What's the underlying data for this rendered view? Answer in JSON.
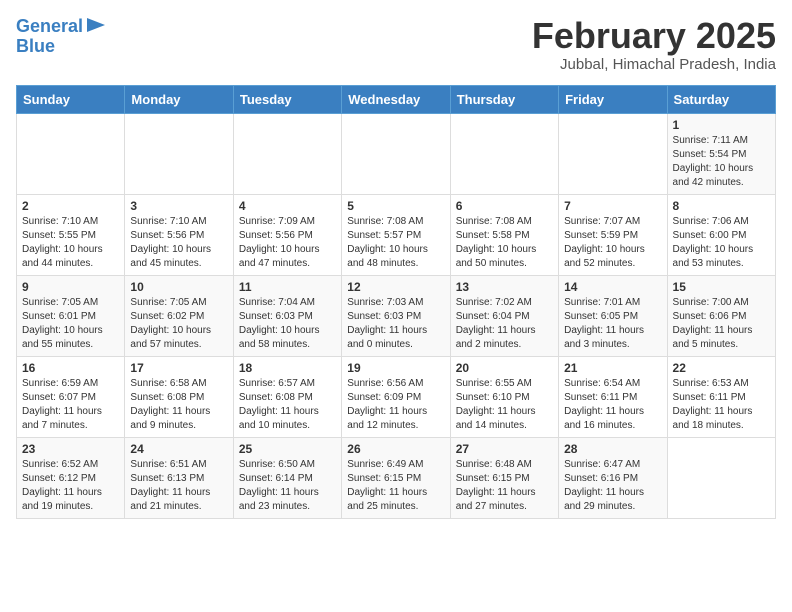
{
  "header": {
    "logo_line1": "General",
    "logo_line2": "Blue",
    "month_title": "February 2025",
    "location": "Jubbal, Himachal Pradesh, India"
  },
  "calendar": {
    "days_of_week": [
      "Sunday",
      "Monday",
      "Tuesday",
      "Wednesday",
      "Thursday",
      "Friday",
      "Saturday"
    ],
    "weeks": [
      [
        {
          "day": "",
          "info": ""
        },
        {
          "day": "",
          "info": ""
        },
        {
          "day": "",
          "info": ""
        },
        {
          "day": "",
          "info": ""
        },
        {
          "day": "",
          "info": ""
        },
        {
          "day": "",
          "info": ""
        },
        {
          "day": "1",
          "info": "Sunrise: 7:11 AM\nSunset: 5:54 PM\nDaylight: 10 hours\nand 42 minutes."
        }
      ],
      [
        {
          "day": "2",
          "info": "Sunrise: 7:10 AM\nSunset: 5:55 PM\nDaylight: 10 hours\nand 44 minutes."
        },
        {
          "day": "3",
          "info": "Sunrise: 7:10 AM\nSunset: 5:56 PM\nDaylight: 10 hours\nand 45 minutes."
        },
        {
          "day": "4",
          "info": "Sunrise: 7:09 AM\nSunset: 5:56 PM\nDaylight: 10 hours\nand 47 minutes."
        },
        {
          "day": "5",
          "info": "Sunrise: 7:08 AM\nSunset: 5:57 PM\nDaylight: 10 hours\nand 48 minutes."
        },
        {
          "day": "6",
          "info": "Sunrise: 7:08 AM\nSunset: 5:58 PM\nDaylight: 10 hours\nand 50 minutes."
        },
        {
          "day": "7",
          "info": "Sunrise: 7:07 AM\nSunset: 5:59 PM\nDaylight: 10 hours\nand 52 minutes."
        },
        {
          "day": "8",
          "info": "Sunrise: 7:06 AM\nSunset: 6:00 PM\nDaylight: 10 hours\nand 53 minutes."
        }
      ],
      [
        {
          "day": "9",
          "info": "Sunrise: 7:05 AM\nSunset: 6:01 PM\nDaylight: 10 hours\nand 55 minutes."
        },
        {
          "day": "10",
          "info": "Sunrise: 7:05 AM\nSunset: 6:02 PM\nDaylight: 10 hours\nand 57 minutes."
        },
        {
          "day": "11",
          "info": "Sunrise: 7:04 AM\nSunset: 6:03 PM\nDaylight: 10 hours\nand 58 minutes."
        },
        {
          "day": "12",
          "info": "Sunrise: 7:03 AM\nSunset: 6:03 PM\nDaylight: 11 hours\nand 0 minutes."
        },
        {
          "day": "13",
          "info": "Sunrise: 7:02 AM\nSunset: 6:04 PM\nDaylight: 11 hours\nand 2 minutes."
        },
        {
          "day": "14",
          "info": "Sunrise: 7:01 AM\nSunset: 6:05 PM\nDaylight: 11 hours\nand 3 minutes."
        },
        {
          "day": "15",
          "info": "Sunrise: 7:00 AM\nSunset: 6:06 PM\nDaylight: 11 hours\nand 5 minutes."
        }
      ],
      [
        {
          "day": "16",
          "info": "Sunrise: 6:59 AM\nSunset: 6:07 PM\nDaylight: 11 hours\nand 7 minutes."
        },
        {
          "day": "17",
          "info": "Sunrise: 6:58 AM\nSunset: 6:08 PM\nDaylight: 11 hours\nand 9 minutes."
        },
        {
          "day": "18",
          "info": "Sunrise: 6:57 AM\nSunset: 6:08 PM\nDaylight: 11 hours\nand 10 minutes."
        },
        {
          "day": "19",
          "info": "Sunrise: 6:56 AM\nSunset: 6:09 PM\nDaylight: 11 hours\nand 12 minutes."
        },
        {
          "day": "20",
          "info": "Sunrise: 6:55 AM\nSunset: 6:10 PM\nDaylight: 11 hours\nand 14 minutes."
        },
        {
          "day": "21",
          "info": "Sunrise: 6:54 AM\nSunset: 6:11 PM\nDaylight: 11 hours\nand 16 minutes."
        },
        {
          "day": "22",
          "info": "Sunrise: 6:53 AM\nSunset: 6:11 PM\nDaylight: 11 hours\nand 18 minutes."
        }
      ],
      [
        {
          "day": "23",
          "info": "Sunrise: 6:52 AM\nSunset: 6:12 PM\nDaylight: 11 hours\nand 19 minutes."
        },
        {
          "day": "24",
          "info": "Sunrise: 6:51 AM\nSunset: 6:13 PM\nDaylight: 11 hours\nand 21 minutes."
        },
        {
          "day": "25",
          "info": "Sunrise: 6:50 AM\nSunset: 6:14 PM\nDaylight: 11 hours\nand 23 minutes."
        },
        {
          "day": "26",
          "info": "Sunrise: 6:49 AM\nSunset: 6:15 PM\nDaylight: 11 hours\nand 25 minutes."
        },
        {
          "day": "27",
          "info": "Sunrise: 6:48 AM\nSunset: 6:15 PM\nDaylight: 11 hours\nand 27 minutes."
        },
        {
          "day": "28",
          "info": "Sunrise: 6:47 AM\nSunset: 6:16 PM\nDaylight: 11 hours\nand 29 minutes."
        },
        {
          "day": "",
          "info": ""
        }
      ]
    ]
  }
}
